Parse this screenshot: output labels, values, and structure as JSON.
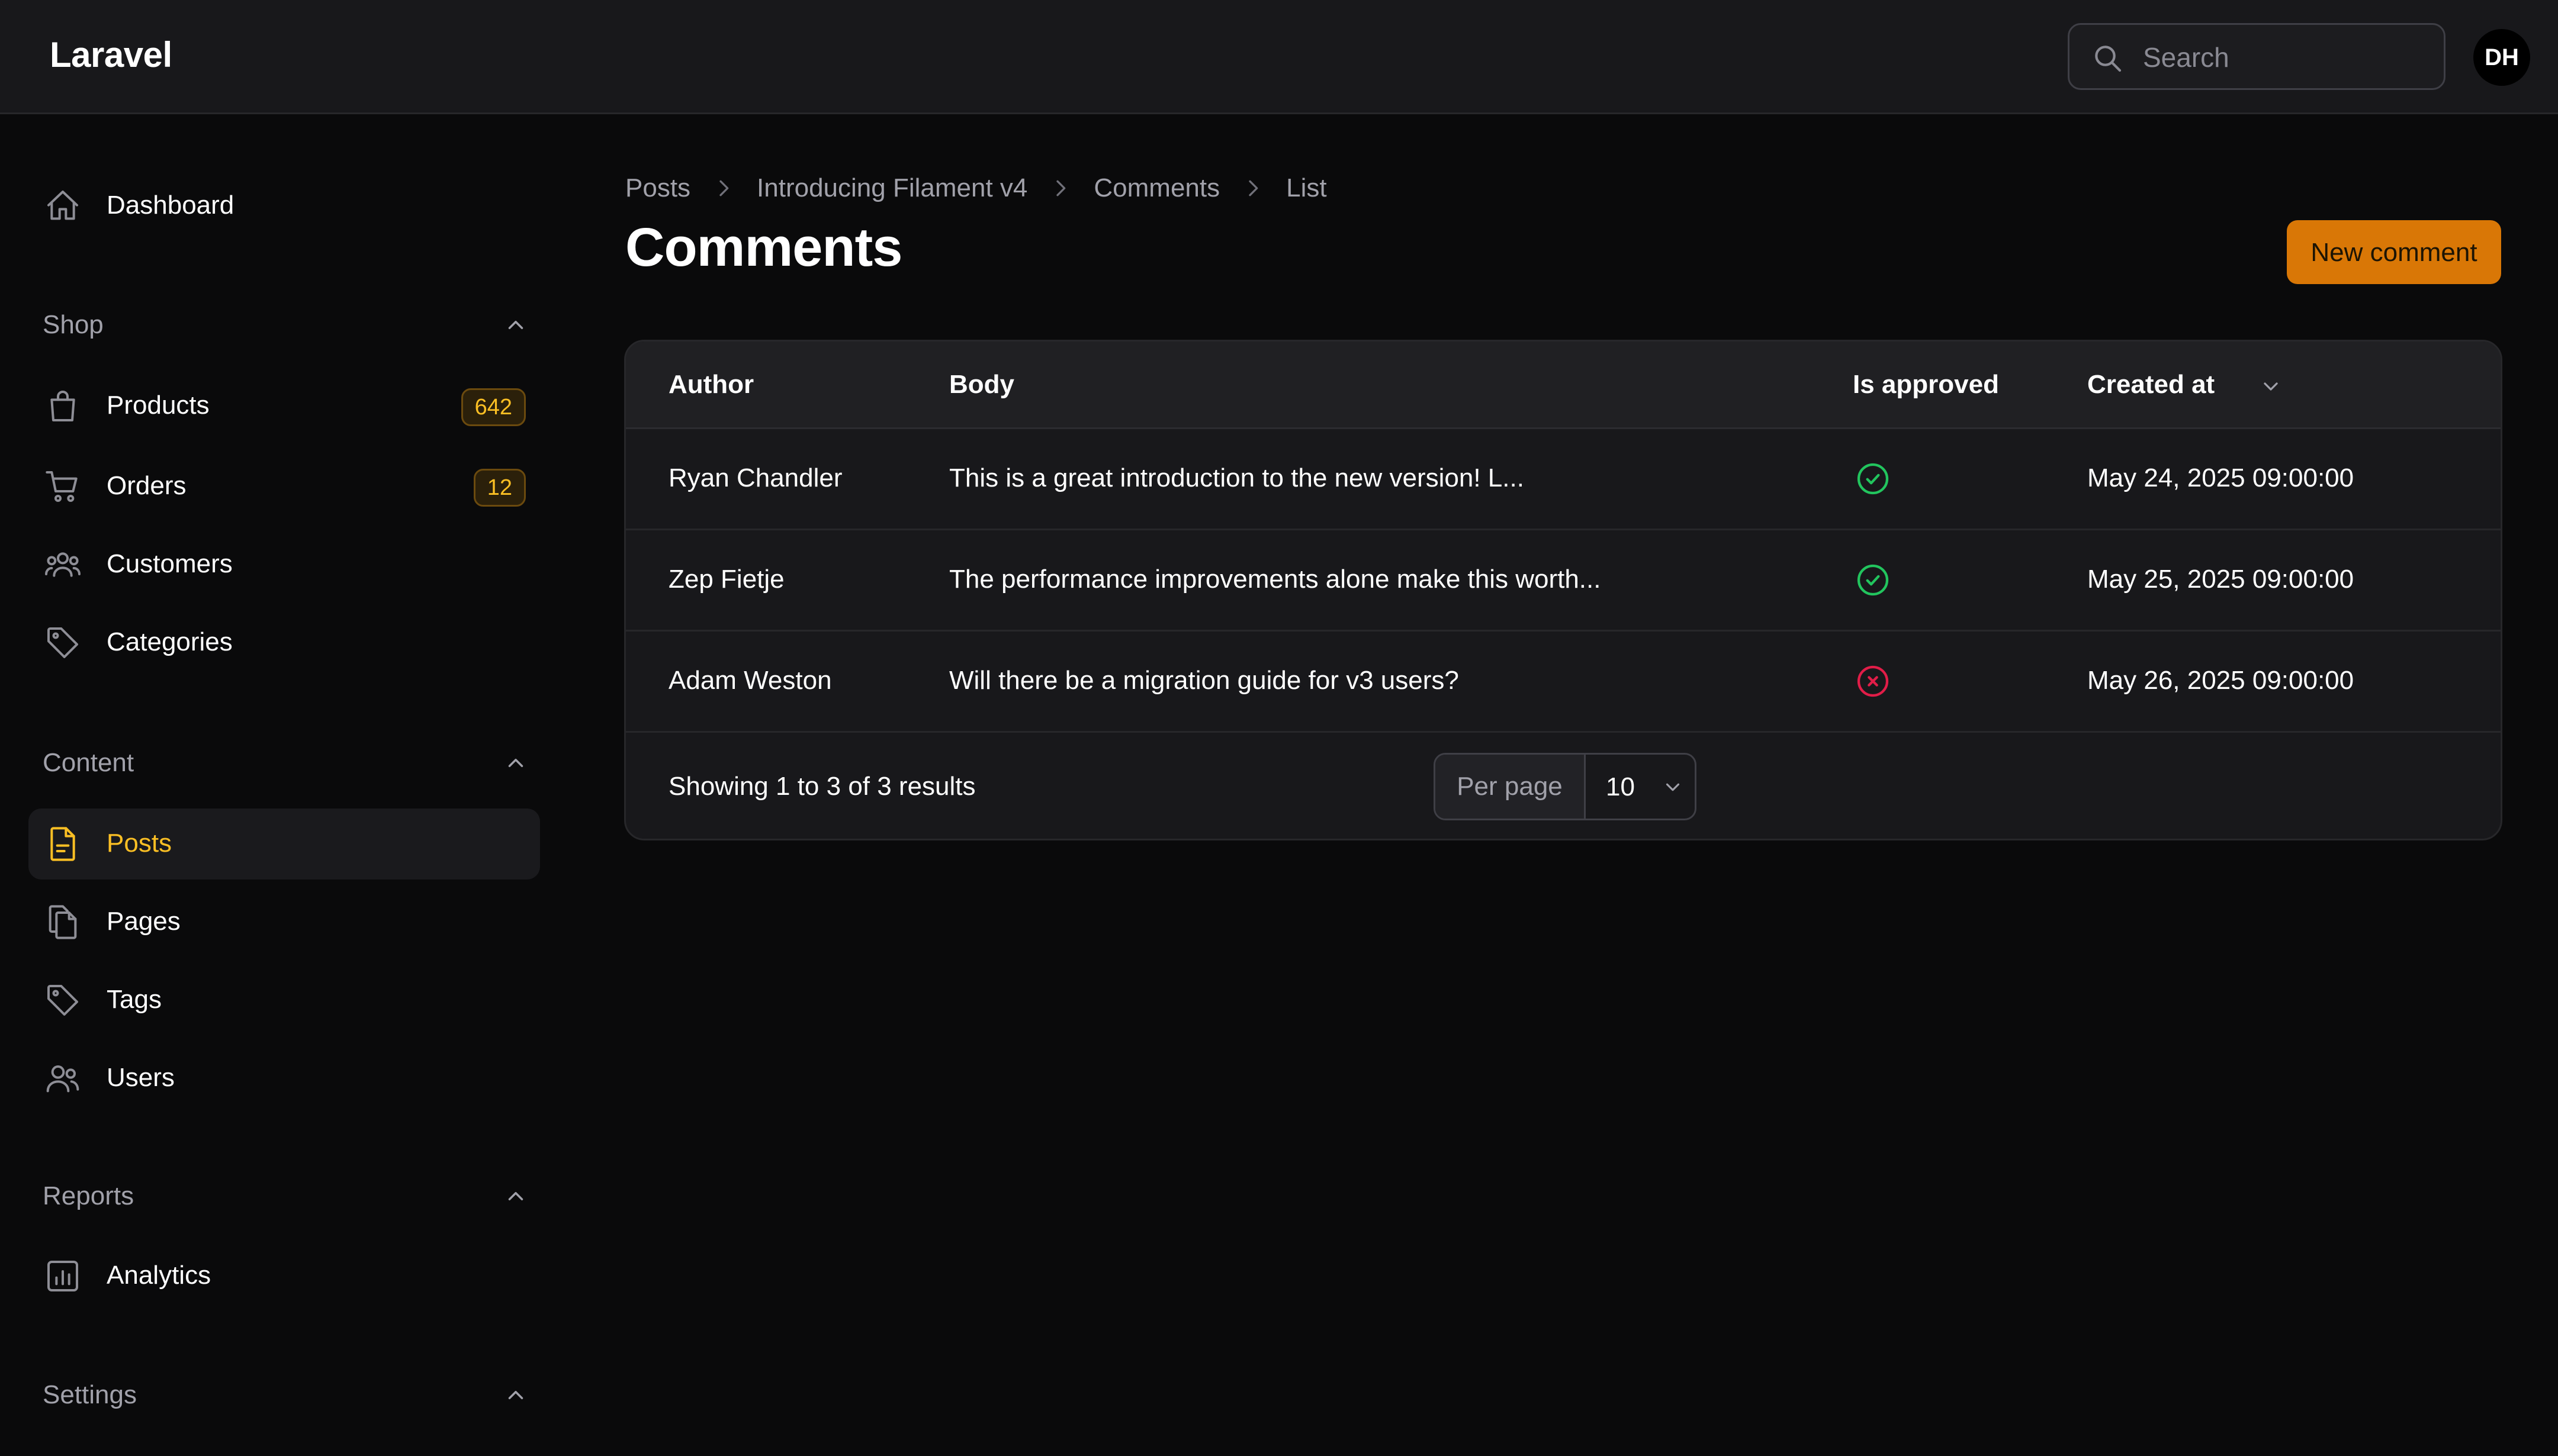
{
  "app": {
    "brand": "Laravel",
    "search_placeholder": "Search",
    "user_initials": "DH"
  },
  "sidebar": {
    "items": [
      {
        "label": "Dashboard",
        "icon": "home-icon"
      }
    ],
    "groups": [
      {
        "label": "Shop",
        "items": [
          {
            "label": "Products",
            "icon": "shopping-bag-icon",
            "badge": "642"
          },
          {
            "label": "Orders",
            "icon": "shopping-cart-icon",
            "badge": "12"
          },
          {
            "label": "Customers",
            "icon": "user-group-icon"
          },
          {
            "label": "Categories",
            "icon": "tag-icon"
          }
        ]
      },
      {
        "label": "Content",
        "items": [
          {
            "label": "Posts",
            "icon": "document-text-icon",
            "active": true
          },
          {
            "label": "Pages",
            "icon": "document-duplicate-icon"
          },
          {
            "label": "Tags",
            "icon": "tag-icon"
          },
          {
            "label": "Users",
            "icon": "users-icon"
          }
        ]
      },
      {
        "label": "Reports",
        "items": [
          {
            "label": "Analytics",
            "icon": "chart-bar-icon"
          }
        ]
      },
      {
        "label": "Settings",
        "items": []
      }
    ]
  },
  "breadcrumbs": [
    "Posts",
    "Introducing Filament v4",
    "Comments",
    "List"
  ],
  "page": {
    "title": "Comments",
    "new_button_label": "New comment"
  },
  "table": {
    "columns": [
      "Author",
      "Body",
      "Is approved",
      "Created at"
    ],
    "sorted_column": "Created at",
    "rows": [
      {
        "author": "Ryan Chandler",
        "body": "This is a great introduction to the new version! L...",
        "approved": true,
        "created_at": "May 24, 2025 09:00:00"
      },
      {
        "author": "Zep Fietje",
        "body": "The performance improvements alone make this worth...",
        "approved": true,
        "created_at": "May 25, 2025 09:00:00"
      },
      {
        "author": "Adam Weston",
        "body": "Will there be a migration guide for v3 users?",
        "approved": false,
        "created_at": "May 26, 2025 09:00:00"
      }
    ],
    "footer": {
      "results_text": "Showing 1 to 3 of 3 results",
      "per_page_label": "Per page",
      "per_page_value": "10"
    }
  },
  "colors": {
    "accent": "#d97706",
    "active_text": "#fbbf24",
    "approved": "#22c55e",
    "rejected": "#e11d48"
  }
}
